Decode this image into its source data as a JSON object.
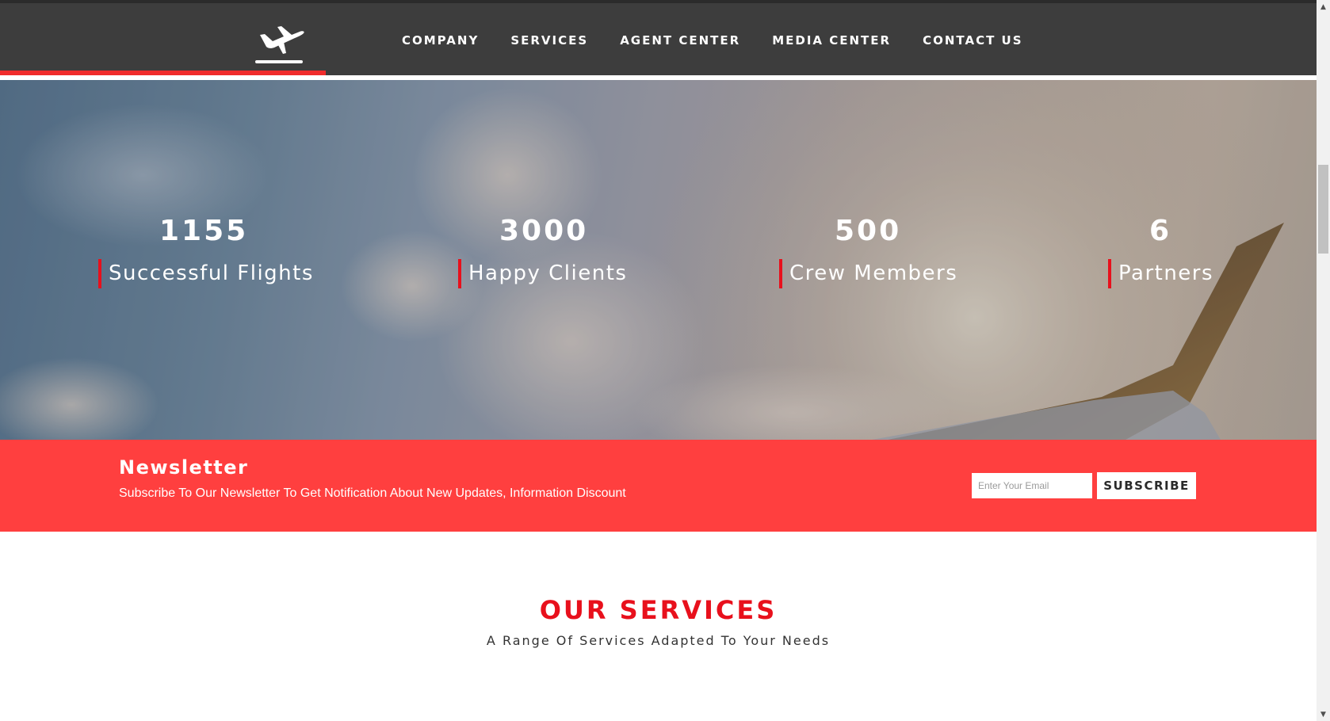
{
  "header": {
    "logo_icon": "airplane-takeoff-icon",
    "nav": [
      {
        "label": "COMPANY"
      },
      {
        "label": "SERVICES"
      },
      {
        "label": "AGENT CENTER"
      },
      {
        "label": "MEDIA CENTER"
      },
      {
        "label": "CONTACT US"
      }
    ]
  },
  "stats": [
    {
      "value": "1155",
      "label": "Successful Flights"
    },
    {
      "value": "3000",
      "label": "Happy Clients"
    },
    {
      "value": "500",
      "label": "Crew Members"
    },
    {
      "value": "6",
      "label": "Partners"
    }
  ],
  "newsletter": {
    "title": "Newsletter",
    "text": "Subscribe To Our Newsletter To Get Notification About New Updates, Information Discount",
    "email_placeholder": "Enter Your Email",
    "email_value": "",
    "subscribe_label": "SUBSCRIBE"
  },
  "services": {
    "title": "OUR SERVICES",
    "subtitle": "A Range Of Services Adapted To Your Needs"
  },
  "colors": {
    "header_bg": "#3d3d3d",
    "accent_red": "#e8101c",
    "newsletter_bg": "#ff3f3f"
  }
}
